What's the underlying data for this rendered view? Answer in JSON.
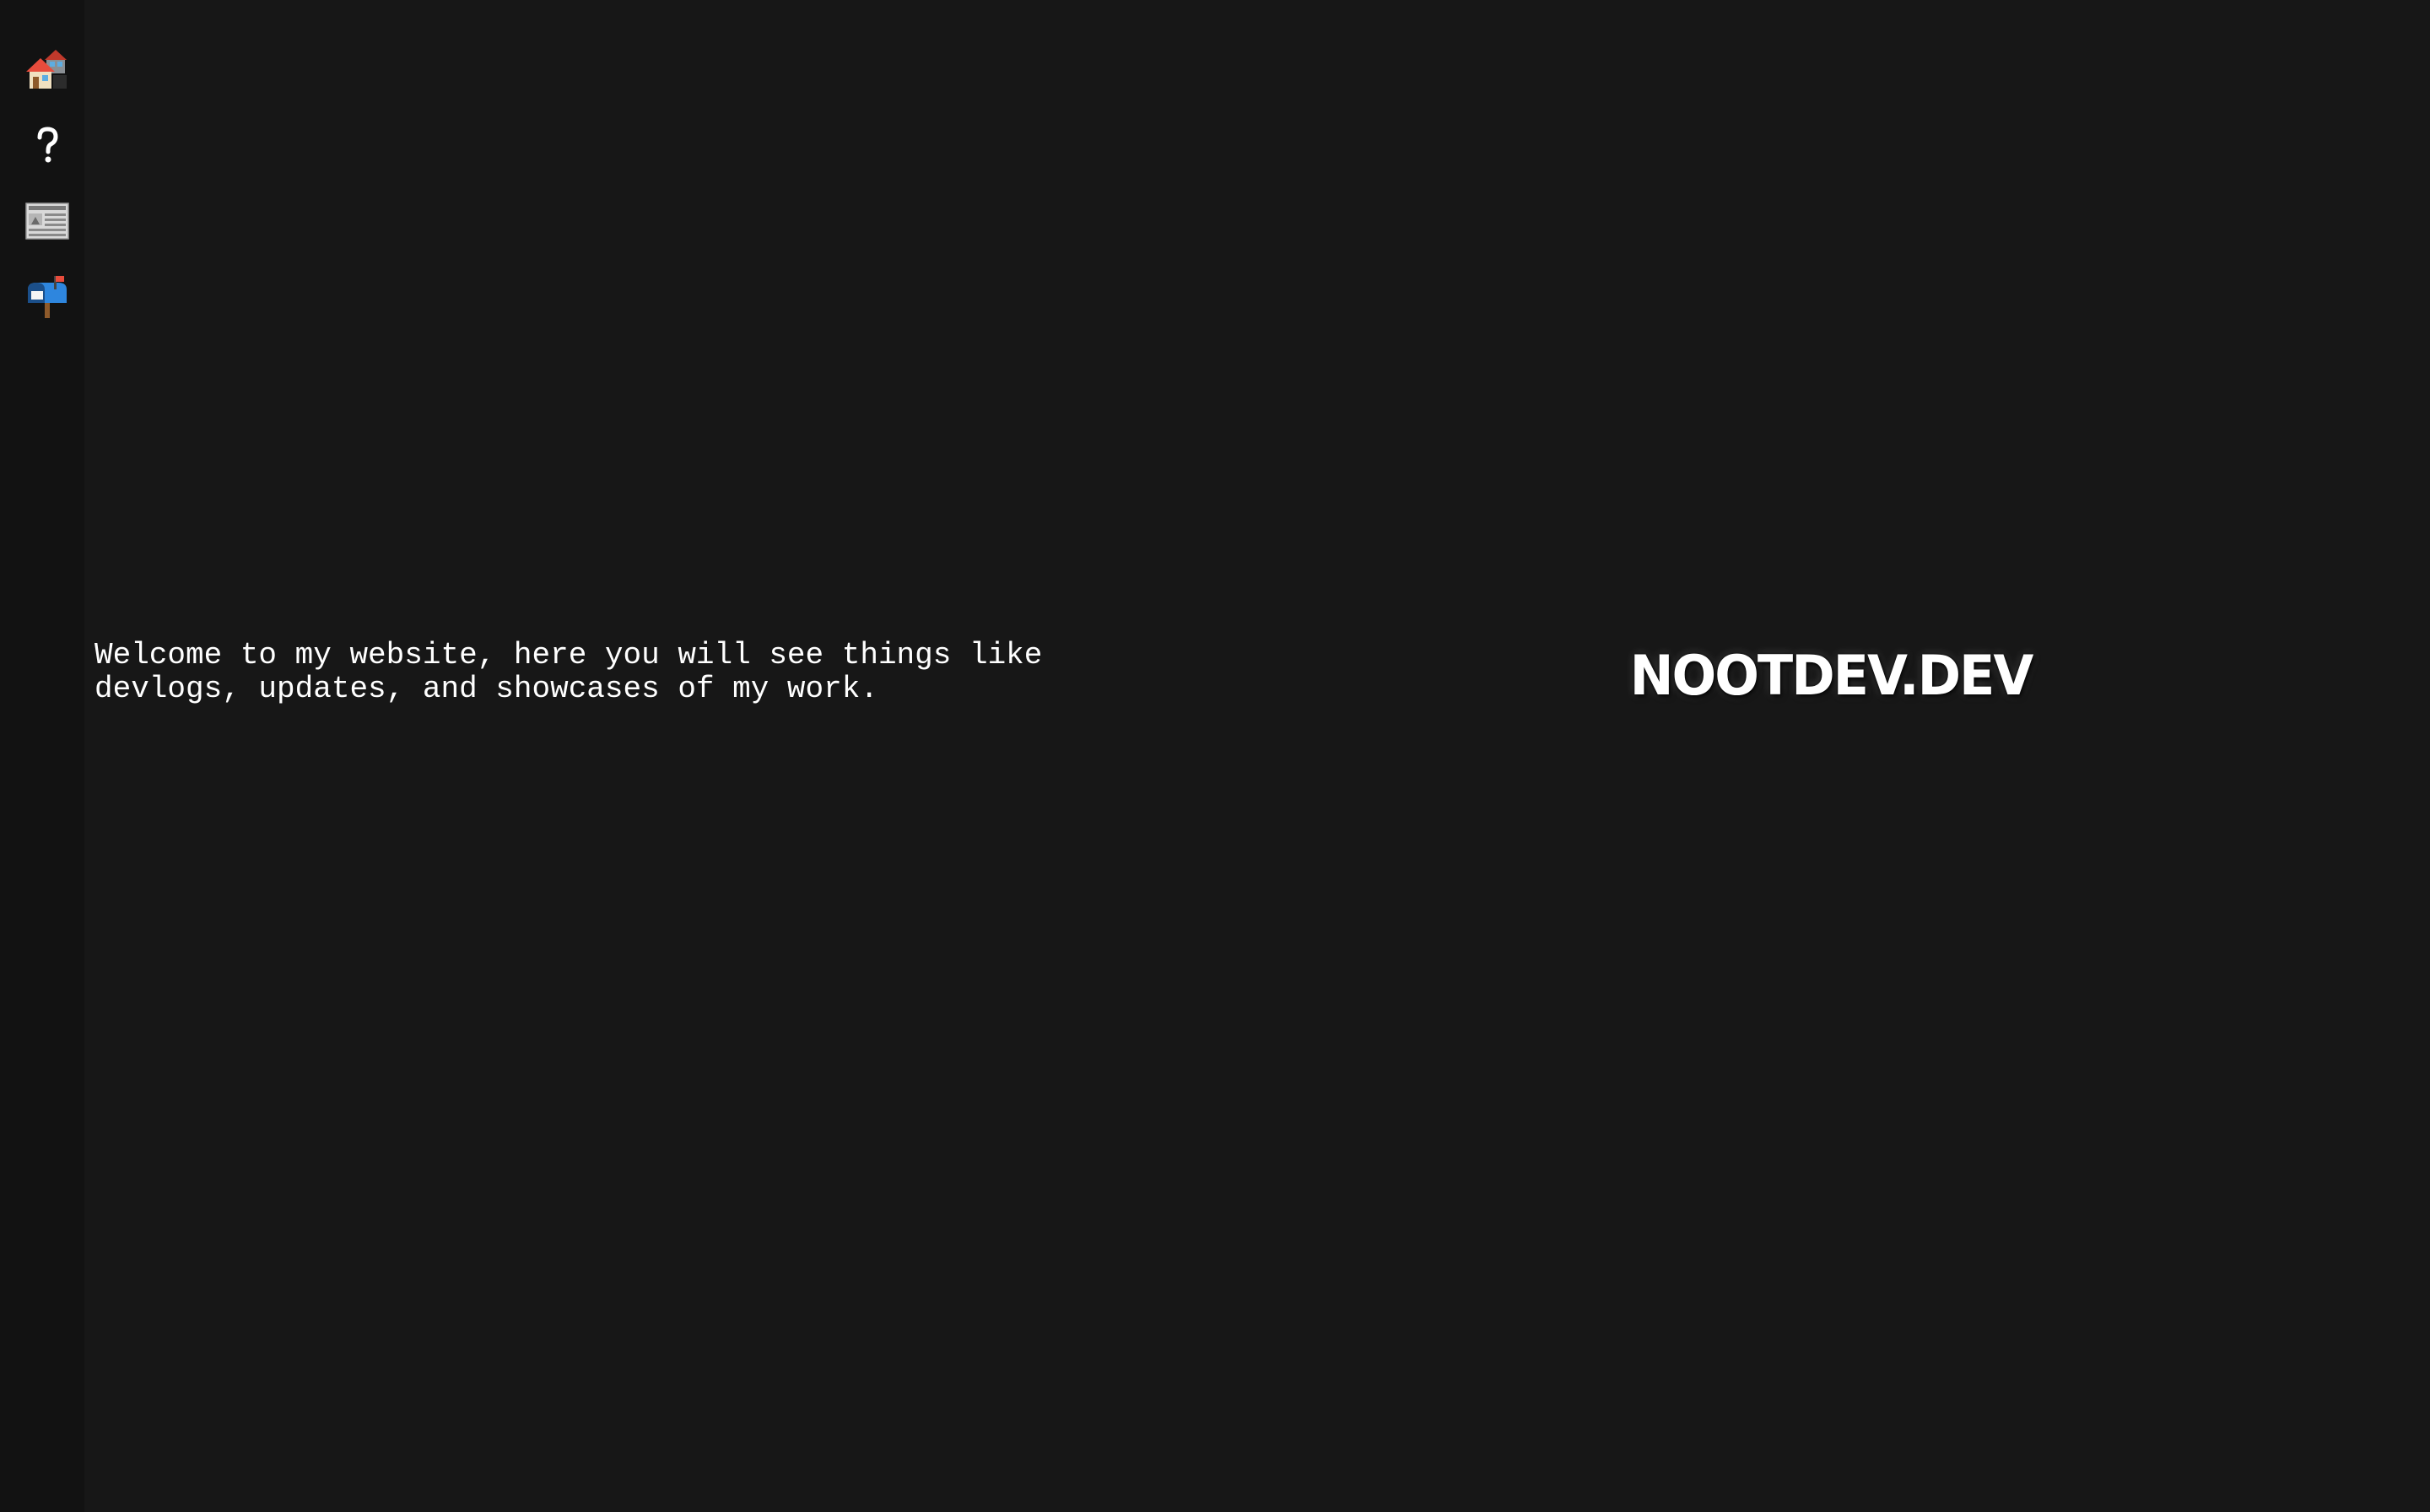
{
  "sidebar": {
    "items": [
      {
        "id": "home",
        "icon": "houses-icon"
      },
      {
        "id": "about",
        "icon": "question-mark-icon"
      },
      {
        "id": "news",
        "icon": "newspaper-icon"
      },
      {
        "id": "contact",
        "icon": "mailbox-icon"
      }
    ]
  },
  "main": {
    "welcome_text": "Welcome to my website, here you will see things like\ndevlogs, updates, and showcases of my work.",
    "logo_text": "NOOTDEV.DEV"
  },
  "colors": {
    "background": "#171717",
    "sidebar_background": "#121212",
    "text": "#ffffff"
  }
}
